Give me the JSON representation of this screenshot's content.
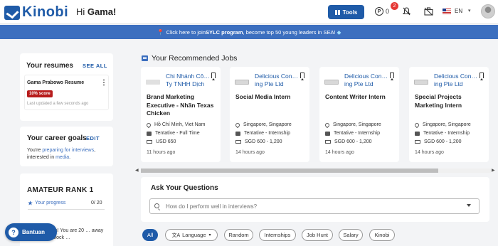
{
  "header": {
    "logo_text": "Kinobi",
    "greeting_prefix": "Hi ",
    "user_name": "Gama!",
    "tools_label": "Tools",
    "points_symbol": "P",
    "points_value": "0",
    "notification_count": "2",
    "language": "EN"
  },
  "banner": {
    "text_before": "Click here to join ",
    "text_bold": "SYLC program",
    "text_after": ", become top 50 young leaders in SEA!"
  },
  "resumes": {
    "title": "Your resumes",
    "see_all": "SEE ALL",
    "items": [
      {
        "name": "Gama Prabowo Resume",
        "score": "10% score",
        "updated": "Last updated a few seconds ago"
      }
    ]
  },
  "goals": {
    "title": "Your career goals",
    "edit": "EDIT",
    "text_before": "You're ",
    "link1": "preparing for interviews",
    "text_middle": ", interested in ",
    "link2": "media",
    "text_after": "."
  },
  "rank": {
    "title": "AMATEUR RANK 1",
    "progress_label": "Your progress",
    "progress_count": "0/ 20",
    "progress_fraction": 0.0,
    "congrats_text": "…rats! You are 20 … away to unlock …"
  },
  "help": {
    "label": "Bantuan"
  },
  "recommended": {
    "title": "Your Recommended Jobs",
    "jobs": [
      {
        "company": "Chi Nhánh Cô… Ty TNHH Dịch …",
        "title": "Brand Marketing Executive - Nhãn Texas Chicken",
        "location": "Hồ Chí Minh, Viet Nam",
        "type": "Tentative - Full Time",
        "salary": "USD 650",
        "posted": "11 hours ago"
      },
      {
        "company": "Delicious Con… ing Pte Ltd",
        "title": "Social Media Intern",
        "location": "Singapore, Singapore",
        "type": "Tentative - Internship",
        "salary": "SGD 600 - 1,200",
        "posted": "14 hours ago"
      },
      {
        "company": "Delicious Con… ing Pte Ltd",
        "title": "Content Writer Intern",
        "location": "Singapore, Singapore",
        "type": "Tentative - Internship",
        "salary": "SGD 600 - 1,200",
        "posted": "14 hours ago"
      },
      {
        "company": "Delicious Con… ing Pte Ltd",
        "title": "Special Projects Marketing Intern",
        "location": "Singapore, Singapore",
        "type": "Tentative - Internship",
        "salary": "SGD 600 - 1,200",
        "posted": "14 hours ago"
      }
    ]
  },
  "ask": {
    "title": "Ask Your Questions",
    "placeholder": "How do I perform well in interviews?"
  },
  "chips": [
    "All",
    "Language",
    "Random",
    "Internships",
    "Job Hunt",
    "Salary",
    "Kinobi"
  ],
  "colors": {
    "brand": "#1f5ba8",
    "banner": "#3c6fbf",
    "badge": "#b71c1c",
    "notification": "#e53935"
  }
}
